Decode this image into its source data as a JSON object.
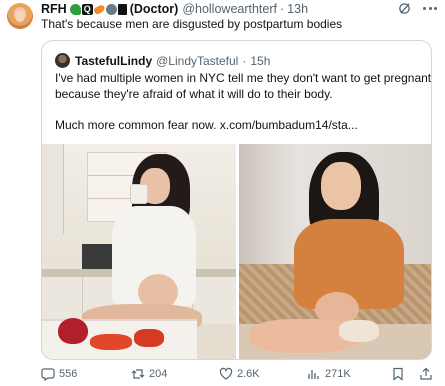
{
  "tweet": {
    "author_name": "RFH",
    "author_suffix": "(Doctor)",
    "handle": "@hollowearthterf",
    "separator": "·",
    "time": "13h",
    "text": "That's because men are disgusted by postpartum bodies"
  },
  "quote": {
    "author_name": "TastefulLindy",
    "handle": "@LindyTasteful",
    "separator": "·",
    "time": "15h",
    "line1": "I've had multiple women in NYC tell me they don't want to get pregnant",
    "line2": "because they're afraid of what it will do to their body.",
    "line3": "Much more common fear now.  x.com/bumbadum14/sta..."
  },
  "actions": {
    "replies": "556",
    "reposts": "204",
    "likes": "2.6K",
    "views": "271K"
  },
  "colors": {
    "text": "#0f1419",
    "secondary": "#536471",
    "border": "#cfd9de"
  },
  "icons": [
    "grok-icon",
    "more-icon",
    "reply-icon",
    "repost-icon",
    "like-icon",
    "views-icon",
    "bookmark-icon",
    "share-icon"
  ]
}
